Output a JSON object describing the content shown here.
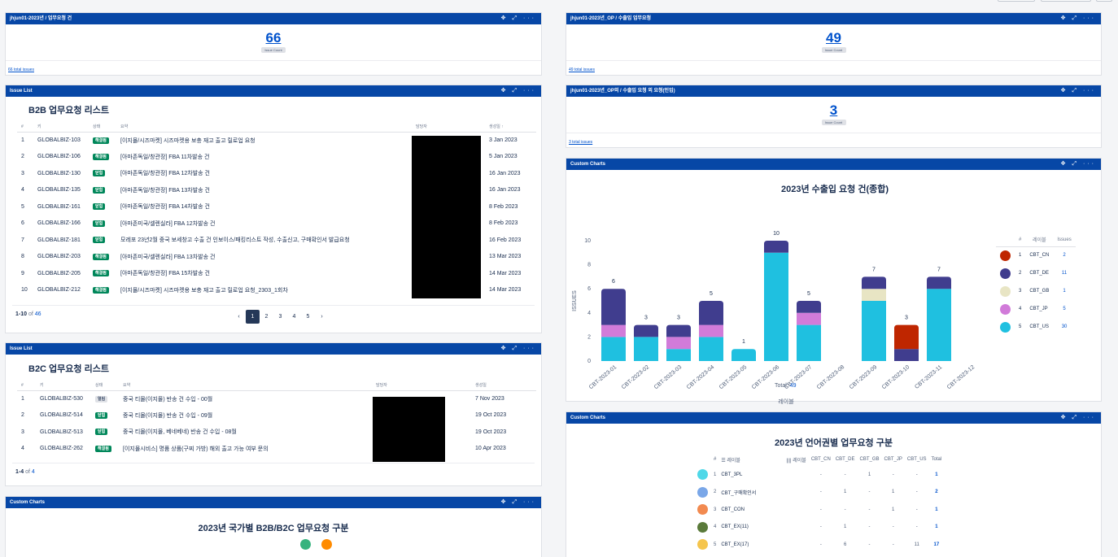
{
  "colors": {
    "header": "#0747a6",
    "CBT_CN": "#bf2600",
    "CBT_DE": "#403d8e",
    "CBT_GB": "#e8e5c4",
    "CBT_JP": "#d17bd9",
    "CBT_US": "#1fc0e0"
  },
  "gadgets": {
    "g1": {
      "title": "jhjun01-2023년 / 업무요청 건",
      "count": "66",
      "count_sub": "Issue Count",
      "total": "66 total issues"
    },
    "g2": {
      "title": "jhjun01-2023년_OP / 수출입 업무요청",
      "count": "49",
      "count_sub": "Issue Count",
      "total": "49 total issues"
    },
    "g3": {
      "title": "jhjun01-2023년_OP외 / 수출입 요청 외 요청(인입)",
      "count": "3",
      "count_sub": "Issue Count",
      "total": "3 total issues"
    },
    "icons": "✥ ⤢ ···"
  },
  "b2b": {
    "header": "Issue List",
    "title": "B2B 업무요청 리스트",
    "columns": [
      "#",
      "키",
      "상태",
      "요약",
      "담당자",
      "생성일 ↑"
    ],
    "rows": [
      {
        "n": "1",
        "key": "GLOBALBIZ-103",
        "status": "해결됨",
        "summary": "[이지몰/시즈마켓] 시즈마켓용 보충 재고 출고 릴로업 요청",
        "date": "3 Jan 2023"
      },
      {
        "n": "2",
        "key": "GLOBALBIZ-106",
        "status": "해결됨",
        "summary": "[아마존독일/창관장] FBA 11차발송 건",
        "date": "5 Jan 2023"
      },
      {
        "n": "3",
        "key": "GLOBALBIZ-130",
        "status": "닫힘",
        "summary": "[아마존독일/창관장] FBA 12차발송 건",
        "date": "16 Jan 2023"
      },
      {
        "n": "4",
        "key": "GLOBALBIZ-135",
        "status": "닫힘",
        "summary": "[아마존독일/창관장] FBA 13차발송 건",
        "date": "16 Jan 2023"
      },
      {
        "n": "5",
        "key": "GLOBALBIZ-161",
        "status": "닫힘",
        "summary": "[아마존독일/창관장] FBA 14차발송 건",
        "date": "8 Feb 2023"
      },
      {
        "n": "6",
        "key": "GLOBALBIZ-166",
        "status": "닫힘",
        "summary": "[아마존미국/셀렌실라] FBA 12차발송 건",
        "date": "8 Feb 2023"
      },
      {
        "n": "7",
        "key": "GLOBALBIZ-181",
        "status": "닫힘",
        "summary": "모레포 23년2월 중국 보세창고 수출 건 인보이스/패킹리스트 작성, 수출신고, 구매확인서 발급요청",
        "date": "16 Feb 2023"
      },
      {
        "n": "8",
        "key": "GLOBALBIZ-203",
        "status": "해결됨",
        "summary": "[아마존미국/셀렌실라] FBA 13차발송 건",
        "date": "13 Mar 2023"
      },
      {
        "n": "9",
        "key": "GLOBALBIZ-205",
        "status": "해결됨",
        "summary": "[아마존독일/창관장] FBA 15차발송 건",
        "date": "14 Mar 2023"
      },
      {
        "n": "10",
        "key": "GLOBALBIZ-212",
        "status": "해결됨",
        "summary": "[이지몰/시즈마켓] 시즈마켓용 보충 재고 출고 릴로업 요청_2303_1회차",
        "date": "14 Mar 2023"
      }
    ],
    "range": "1-10",
    "of": "of",
    "total": "46",
    "pages": [
      "‹",
      "1",
      "2",
      "3",
      "4",
      "5",
      "›"
    ]
  },
  "b2c": {
    "header": "Issue List",
    "title": "B2C 업무요청 리스트",
    "columns": [
      "#",
      "키",
      "상태",
      "요약",
      "담당자",
      "생성일"
    ],
    "rows": [
      {
        "n": "1",
        "key": "GLOBALBIZ-530",
        "status": "열림",
        "summary": "중국 티몰(이지몰) 반송 건 수입 - 00월",
        "date": "7 Nov 2023"
      },
      {
        "n": "2",
        "key": "GLOBALBIZ-514",
        "status": "닫힘",
        "summary": "중국 티몰(이지몰) 반송 건 수입 - 09월",
        "date": "19 Oct 2023"
      },
      {
        "n": "3",
        "key": "GLOBALBIZ-513",
        "status": "닫힘",
        "summary": "중국 티몰(이지몰, 베네베네) 반송 건 수입 - 08월",
        "date": "19 Oct 2023"
      },
      {
        "n": "4",
        "key": "GLOBALBIZ-262",
        "status": "해결됨",
        "summary": "[이지몰시비스] 명품 상품(구찌 가방) 해외 출고 가능 여부 문의",
        "date": "10 Apr 2023"
      }
    ],
    "range": "1-4",
    "of": "of",
    "total": "4"
  },
  "country_chart": {
    "header": "Custom Charts",
    "title": "2023년 국가별 B2B/B2C 업무요청 구분"
  },
  "chart_data": {
    "type": "bar",
    "header": "Custom Charts",
    "title": "2023년 수출입 요청 건(종합)",
    "ylabel": "ISSUES",
    "xlabel": "레이블",
    "ylim": [
      0,
      10
    ],
    "yticks": [
      "0",
      "2",
      "4",
      "6",
      "8",
      "10"
    ],
    "categories": [
      "CBT-2023-01",
      "CBT-2023-02",
      "CBT-2023-03",
      "CBT-2023-04",
      "CBT-2023-05",
      "CBT-2023-06",
      "CBT-2023-07",
      "CBT-2023-08",
      "CBT-2023-09",
      "CBT-2023-10",
      "CBT-2023-11",
      "CBT-2023-12"
    ],
    "totals": [
      "6",
      "3",
      "3",
      "5",
      "1",
      "10",
      "5",
      "",
      "7",
      "3",
      "7",
      ""
    ],
    "series": [
      {
        "name": "CBT_US",
        "color": "#1fc0e0",
        "values": [
          2,
          2,
          1,
          2,
          1,
          9,
          3,
          0,
          5,
          0,
          6,
          0
        ]
      },
      {
        "name": "CBT_JP",
        "color": "#d17bd9",
        "values": [
          1,
          0,
          1,
          1,
          0,
          0,
          1,
          0,
          0,
          0,
          0,
          0
        ]
      },
      {
        "name": "CBT_GB",
        "color": "#e8e5c4",
        "values": [
          0,
          0,
          0,
          0,
          0,
          0,
          0,
          0,
          1,
          0,
          0,
          0
        ]
      },
      {
        "name": "CBT_DE",
        "color": "#403d8e",
        "values": [
          3,
          1,
          1,
          2,
          0,
          1,
          1,
          0,
          1,
          1,
          1,
          0
        ]
      },
      {
        "name": "CBT_CN",
        "color": "#bf2600",
        "values": [
          0,
          0,
          0,
          0,
          0,
          0,
          0,
          0,
          0,
          2,
          0,
          0
        ]
      }
    ],
    "legend": {
      "columns": [
        "#",
        "레이블",
        "Issues"
      ],
      "rows": [
        {
          "n": "1",
          "label": "CBT_CN",
          "issues": "2",
          "color": "#bf2600"
        },
        {
          "n": "2",
          "label": "CBT_DE",
          "issues": "11",
          "color": "#403d8e"
        },
        {
          "n": "3",
          "label": "CBT_GB",
          "issues": "1",
          "color": "#e8e5c4"
        },
        {
          "n": "4",
          "label": "CBT_JP",
          "issues": "5",
          "color": "#d17bd9"
        },
        {
          "n": "5",
          "label": "CBT_US",
          "issues": "30",
          "color": "#1fc0e0"
        }
      ]
    },
    "total_label": "Total:",
    "total": "49"
  },
  "lang_table": {
    "header": "Custom Charts",
    "title": "2023년 언어권별 업무요청 구분",
    "columns": [
      "#",
      "☰ 레이블",
      "|||| 레이블",
      "CBT_CN",
      "CBT_DE",
      "CBT_GB",
      "CBT_JP",
      "CBT_US",
      "Total"
    ],
    "rows": [
      {
        "n": "1",
        "label": "CBT_3PL",
        "color": "#4fd8e8",
        "cells": [
          "-",
          "-",
          "1",
          "-",
          "-"
        ],
        "total": "1"
      },
      {
        "n": "2",
        "label": "CBT_구매확인서",
        "color": "#7aa7e8",
        "cells": [
          "-",
          "1",
          "-",
          "1",
          "-"
        ],
        "total": "2"
      },
      {
        "n": "3",
        "label": "CBT_CON",
        "color": "#f28a50",
        "cells": [
          "-",
          "-",
          "-",
          "1",
          "-"
        ],
        "total": "1"
      },
      {
        "n": "4",
        "label": "CBT_EX(11)",
        "color": "#5a7a3a",
        "cells": [
          "-",
          "1",
          "-",
          "-",
          "-"
        ],
        "total": "1"
      },
      {
        "n": "5",
        "label": "CBT_EX(17)",
        "color": "#f5c54d",
        "cells": [
          "-",
          "6",
          "-",
          "-",
          "11"
        ],
        "total": "17"
      }
    ]
  }
}
